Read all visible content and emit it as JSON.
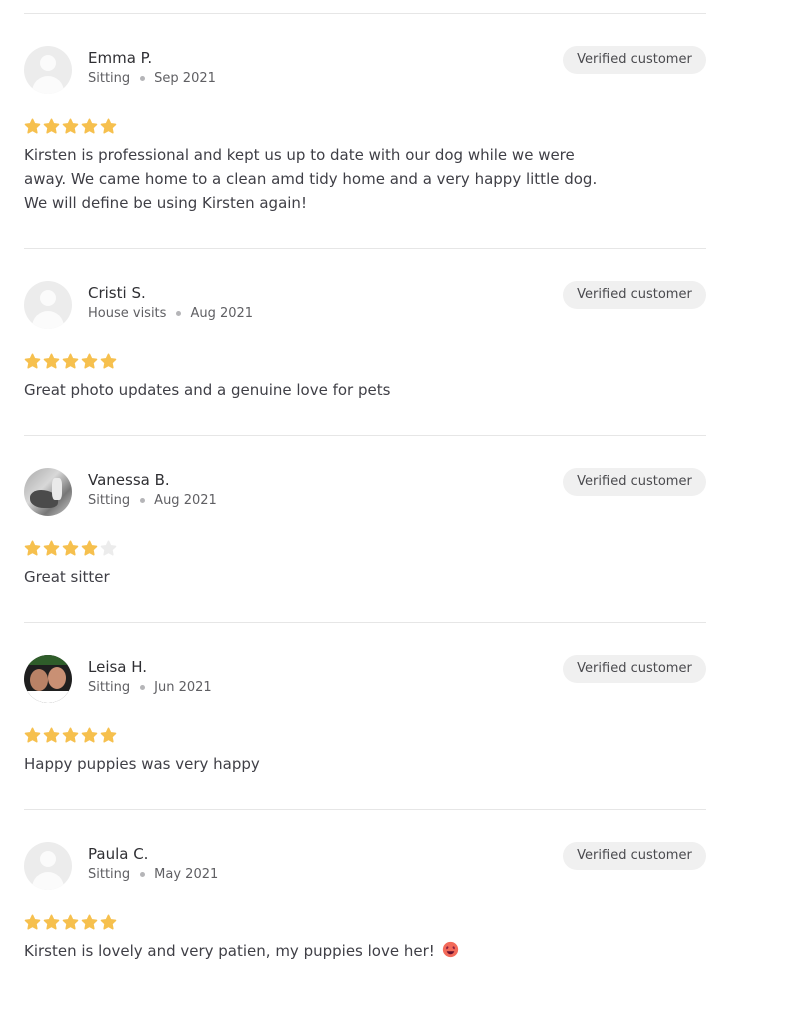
{
  "colors": {
    "star_filled": "#f6c04e",
    "star_empty": "#ececec",
    "badge_bg": "#f0f0f0",
    "divider": "#e6e6e6"
  },
  "reviews": [
    {
      "name": "Emma P.",
      "service": "Sitting",
      "date": "Sep 2021",
      "badge": "Verified customer",
      "rating": 5,
      "avatar": "default-avatar",
      "text": "Kirsten is professional and kept us up to date with our dog while we were away. We came home to a clean amd tidy home and a very happy little dog. We will define be using Kirsten again!"
    },
    {
      "name": "Cristi S.",
      "service": "House visits",
      "date": "Aug 2021",
      "badge": "Verified customer",
      "rating": 5,
      "avatar": "default-avatar",
      "text": "Great photo updates and a genuine love for pets"
    },
    {
      "name": "Vanessa B.",
      "service": "Sitting",
      "date": "Aug 2021",
      "badge": "Verified customer",
      "rating": 4,
      "avatar": "photo-avatar",
      "text": "Great sitter"
    },
    {
      "name": "Leisa H.",
      "service": "Sitting",
      "date": "Jun 2021",
      "badge": "Verified customer",
      "rating": 5,
      "avatar": "photo-avatar",
      "text": "Happy puppies was very happy"
    },
    {
      "name": "Paula C.",
      "service": "Sitting",
      "date": "May 2021",
      "badge": "Verified customer",
      "rating": 5,
      "avatar": "default-avatar",
      "text": "Kirsten is lovely and very patien, my puppies love her!",
      "emoji": "heart-eyes-emoji"
    }
  ]
}
